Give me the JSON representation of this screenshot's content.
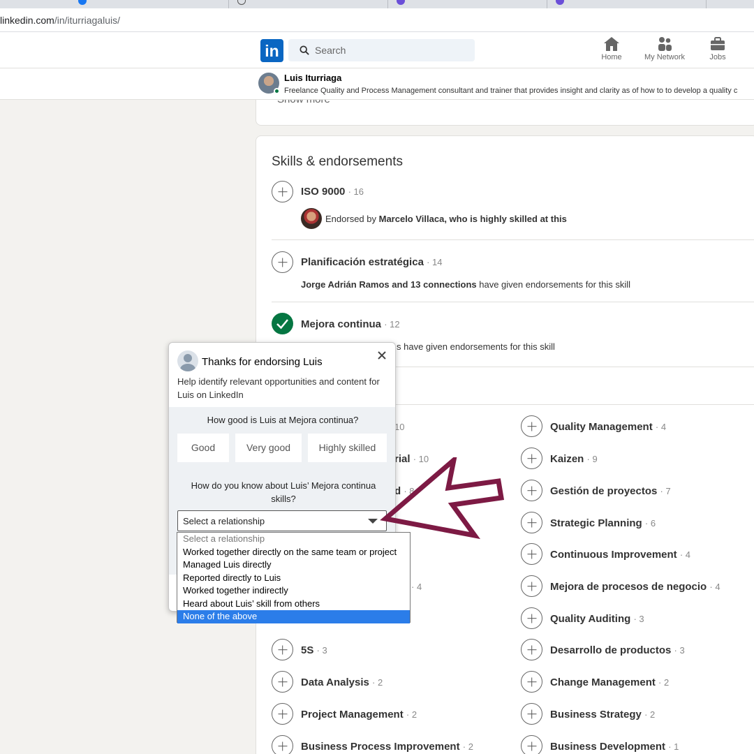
{
  "browser": {
    "url_host": "linkedin.com",
    "url_path": "/in/iturriagaluis/"
  },
  "nav": {
    "logo": "in",
    "search_placeholder": "Search",
    "items": [
      {
        "label": "Home",
        "icon": "home-icon"
      },
      {
        "label": "My Network",
        "icon": "network-icon"
      },
      {
        "label": "Jobs",
        "icon": "briefcase-icon"
      }
    ]
  },
  "profile": {
    "name": "Luis Iturriaga",
    "headline": "Freelance Quality and Process Management consultant and trainer that provides insight and clarity as of how to to develop a quality c",
    "show_more": "Show more"
  },
  "skills_section": {
    "title": "Skills & endorsements",
    "top_skills": [
      {
        "name": "ISO 9000",
        "count": "· 16",
        "endorsed": false,
        "line_prefix": "Endorsed by ",
        "line_bold": "Marcelo Villaca, who is highly skilled at this",
        "line_suffix": ""
      },
      {
        "name": "Planificación estratégica",
        "count": "· 14",
        "endorsed": false,
        "line_prefix": "",
        "line_bold": "Jorge Adrián Ramos and 13 connections",
        "line_suffix": " have given endorsements for this skill"
      },
      {
        "name": "Mejora continua",
        "count": "· 12",
        "endorsed": true,
        "line_prefix": "",
        "line_bold": "",
        "line_suffix": "s have given endorsements for this skill"
      }
    ],
    "left_column_partial": [
      {
        "name": "",
        "count": "10"
      },
      {
        "name": "rial",
        "count": "· 10"
      },
      {
        "name": "d",
        "count": "· 8"
      },
      {
        "name": "",
        "count": "· 4"
      }
    ],
    "left_column": [
      {
        "name": "5S",
        "count": "· 3"
      },
      {
        "name": "Data Analysis",
        "count": "· 2"
      },
      {
        "name": "Project Management",
        "count": "· 2"
      },
      {
        "name": "Business Process Improvement",
        "count": "· 2"
      }
    ],
    "right_column": [
      {
        "name": "Quality Management",
        "count": "· 4"
      },
      {
        "name": "Kaizen",
        "count": "· 9"
      },
      {
        "name": "Gestión de proyectos",
        "count": "· 7"
      },
      {
        "name": "Strategic Planning",
        "count": "· 6"
      },
      {
        "name": "Continuous Improvement",
        "count": "· 4"
      },
      {
        "name": "Mejora de procesos de negocio",
        "count": "· 4"
      },
      {
        "name": "Quality Auditing",
        "count": "· 3"
      },
      {
        "name": "Desarrollo de productos",
        "count": "· 3"
      },
      {
        "name": "Change Management",
        "count": "· 2"
      },
      {
        "name": "Business Strategy",
        "count": "· 2"
      },
      {
        "name": "Business Development",
        "count": "· 1"
      }
    ]
  },
  "popup": {
    "title": "Thanks for endorsing Luis",
    "subtitle": "Help identify relevant opportunities and content for Luis on LinkedIn",
    "question1": "How good is Luis at Mejora continua?",
    "ratings": [
      "Good",
      "Very good",
      "Highly skilled"
    ],
    "question2": "How do you know about Luis’ Mejora continua skills?",
    "select_value": "Select a relationship",
    "options": [
      "Select a relationship",
      "Worked together directly on the same team or project",
      "Managed Luis directly",
      "Reported directly to Luis",
      "Worked together indirectly",
      "Heard about Luis’ skill from others",
      "None of the above"
    ],
    "highlighted_option_index": 6
  },
  "colors": {
    "linkedin_blue": "#0a66c2",
    "endorsed_green": "#057642",
    "annotation_arrow": "#7d1a44",
    "highlight": "#2b7de9"
  }
}
